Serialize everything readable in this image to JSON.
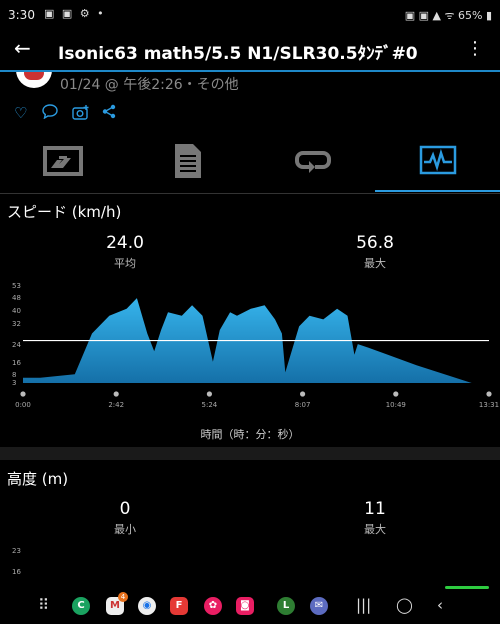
{
  "status": {
    "time": "3:30",
    "battery": "65%"
  },
  "header": {
    "title": "Isonic63  math5/5.5  N1/SLR30.5ﾀﾝﾃﾞ#0"
  },
  "meta": {
    "date_text": "01/24 @ 午後2:26・その他"
  },
  "speed": {
    "title": "スピード (km/h)",
    "avg_value": "24.0",
    "avg_label": "平均",
    "max_value": "56.8",
    "max_label": "最大",
    "axis_caption": "時間（時：分：秒）",
    "y_ticks": [
      "53",
      "48",
      "40",
      "32",
      "24",
      "16",
      "8",
      "3"
    ],
    "x_ticks": [
      "0:00",
      "2:42",
      "5:24",
      "8:07",
      "10:49",
      "13:31"
    ]
  },
  "elevation": {
    "title": "高度 (m)",
    "min_value": "0",
    "min_label": "最小",
    "max_value": "11",
    "max_label": "最大",
    "y_ticks": [
      "23",
      "16"
    ]
  },
  "nav": {
    "badge": "4"
  },
  "colors": {
    "accent": "#2b9be0",
    "fill": "#29a3dc",
    "background": "#000000"
  },
  "chart_data": {
    "type": "area",
    "title": "スピード (km/h)",
    "xlabel": "時間（時：分：秒）",
    "ylabel": "",
    "x_tick_labels": [
      "0:00",
      "2:42",
      "5:24",
      "8:07",
      "10:49",
      "13:31"
    ],
    "x_range_min": [
      0,
      13.5
    ],
    "ylim": [
      0,
      56
    ],
    "average_line": 24.0,
    "series": [
      {
        "x_min": [
          0,
          0.5,
          1.5,
          2.0,
          2.5,
          3.0,
          3.3,
          3.6,
          3.8,
          4.0,
          4.2,
          4.6,
          4.9,
          5.2,
          5.5,
          5.7,
          6.0,
          6.2,
          6.6,
          7.0,
          7.3,
          7.5,
          7.6,
          8.0,
          8.3,
          8.7,
          9.1,
          9.4,
          9.6,
          9.7,
          10.0,
          11.4,
          13.0
        ],
        "values": [
          3,
          3,
          5,
          28,
          38,
          42,
          48,
          28,
          18,
          30,
          40,
          38,
          44,
          38,
          12,
          30,
          40,
          38,
          42,
          44,
          36,
          28,
          6,
          32,
          38,
          36,
          42,
          38,
          16,
          22,
          20,
          10,
          0
        ]
      }
    ]
  }
}
